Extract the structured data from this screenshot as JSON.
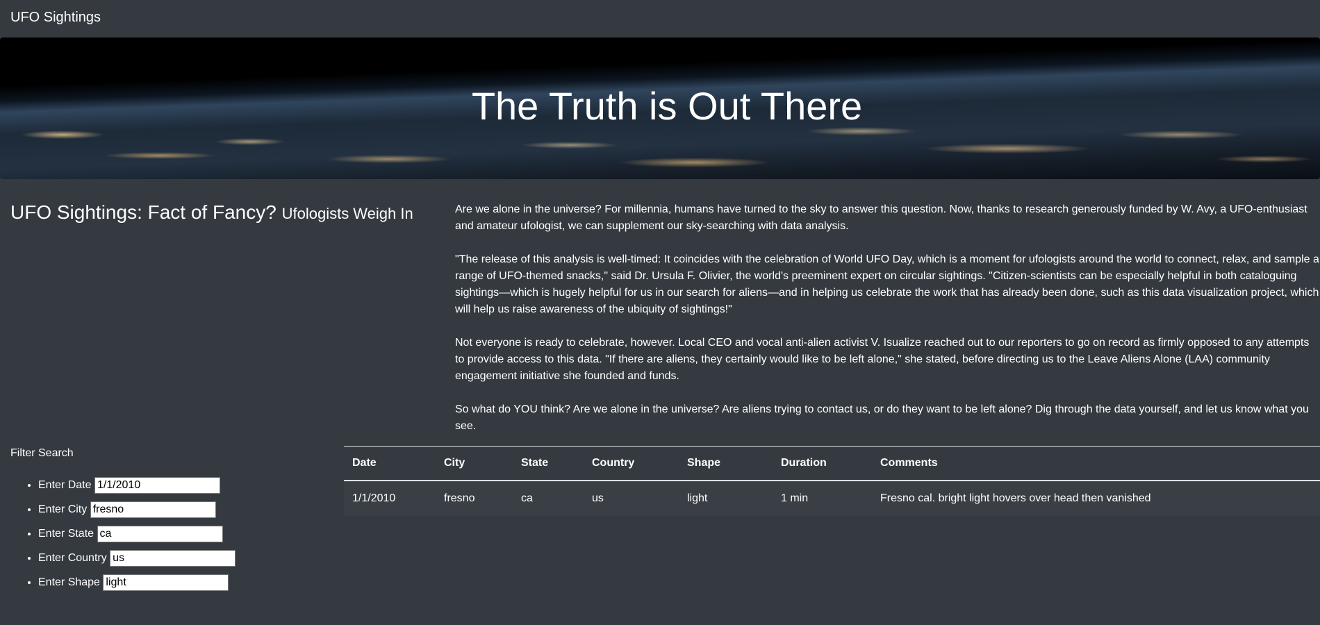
{
  "navbar": {
    "brand": "UFO Sightings"
  },
  "hero": {
    "title": "The Truth is Out There"
  },
  "headline": {
    "main": "UFO Sightings: Fact of Fancy?",
    "small": "Ufologists Weigh In"
  },
  "article": {
    "paragraphs": [
      "Are we alone in the universe? For millennia, humans have turned to the sky to answer this question. Now, thanks to research generously funded by W. Avy, a UFO-enthusiast and amateur ufologist, we can supplement our sky-searching with data analysis.",
      "\"The release of this analysis is well-timed: It coincides with the celebration of World UFO Day, which is a moment for ufologists around the world to connect, relax, and sample a range of UFO-themed snacks,\" said Dr. Ursula F. Olivier, the world's preeminent expert on circular sightings. \"Citizen-scientists can be especially helpful in both cataloguing sightings—which is hugely helpful for us in our search for aliens—and in helping us celebrate the work that has already been done, such as this data visualization project, which will help us raise awareness of the ubiquity of sightings!\"",
      "Not everyone is ready to celebrate, however. Local CEO and vocal anti-alien activist V. Isualize reached out to our reporters to go on record as firmly opposed to any attempts to provide access to this data. \"If there are aliens, they certainly would like to be left alone,\" she stated, before directing us to the Leave Aliens Alone (LAA) community engagement initiative she founded and funds.",
      "So what do YOU think? Are we alone in the universe? Are aliens trying to contact us, or do they want to be left alone? Dig through the data yourself, and let us know what you see."
    ]
  },
  "filters": {
    "title": "Filter Search",
    "items": [
      {
        "label": "Enter Date",
        "value": "1/1/2010"
      },
      {
        "label": "Enter City",
        "value": "fresno"
      },
      {
        "label": "Enter State",
        "value": "ca"
      },
      {
        "label": "Enter Country",
        "value": "us"
      },
      {
        "label": "Enter Shape",
        "value": "light"
      }
    ]
  },
  "table": {
    "headers": [
      "Date",
      "City",
      "State",
      "Country",
      "Shape",
      "Duration",
      "Comments"
    ],
    "rows": [
      [
        "1/1/2010",
        "fresno",
        "ca",
        "us",
        "light",
        "1 min",
        "Fresno cal. bright light hovers over head then vanished"
      ]
    ]
  }
}
